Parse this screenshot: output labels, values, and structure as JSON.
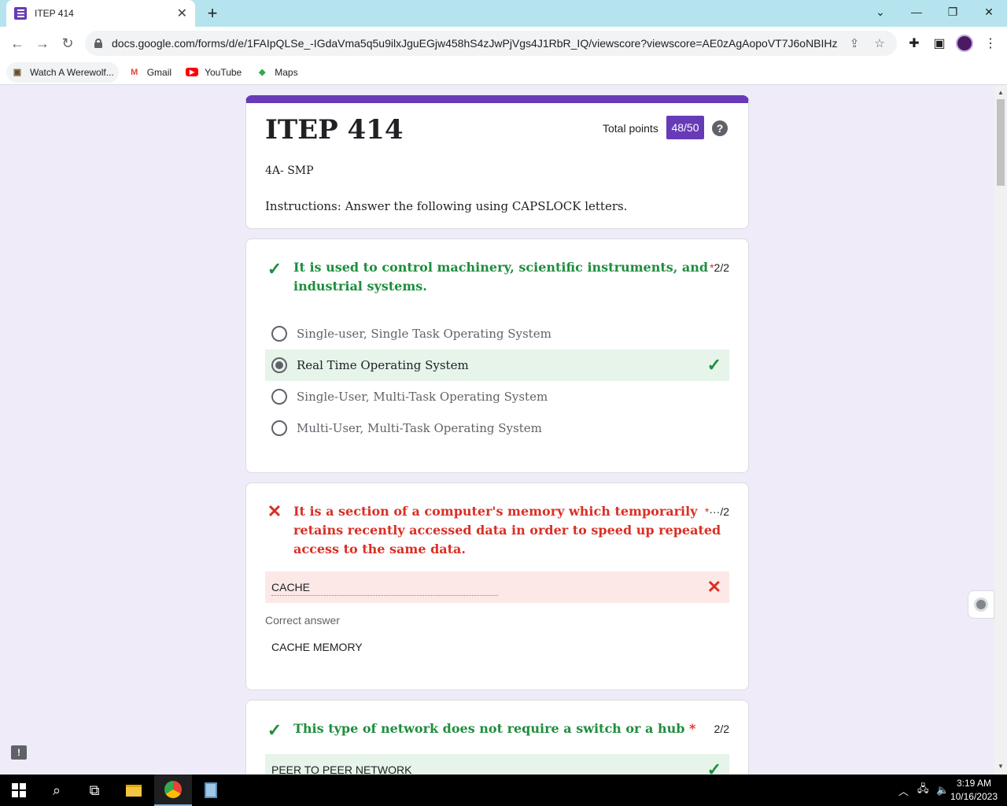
{
  "browser": {
    "tab_title": "ITEP 414",
    "url": "docs.google.com/forms/d/e/1FAIpQLSe_-IGdaVma5q5u9ilxJguEGjw458hS4zJwPjVgs4J1RbR_IQ/viewscore?viewscore=AE0zAgAopoVT7J6oNBIHz3i8u...",
    "bookmarks": [
      {
        "label": "Watch A Werewolf..."
      },
      {
        "label": "Gmail"
      },
      {
        "label": "YouTube"
      },
      {
        "label": "Maps"
      }
    ]
  },
  "form": {
    "title": "ITEP 414",
    "total_label": "Total points",
    "score": "48/50",
    "subtitle": "4A- SMP",
    "instructions": "Instructions: Answer the following using CAPSLOCK letters."
  },
  "questions": [
    {
      "text_line1": "It is used to control machinery, scientific instruments, and",
      "text_line2": "industrial systems.",
      "required_mark": "*",
      "points": "2/2",
      "options": [
        "Single-user, Single Task Operating System",
        "Real Time Operating System",
        "Single-User, Multi-Task Operating System",
        "Multi-User, Multi-Task Operating System"
      ]
    },
    {
      "text_line1": "It is a section of a computer's memory which temporarily",
      "text_line2": "retains recently accessed data in order to speed up repeated",
      "text_line3": "access to the same data.",
      "required_mark": "*",
      "points": "···/2",
      "answer": "CACHE",
      "correct_label": "Correct answer",
      "correct_value": "CACHE MEMORY"
    },
    {
      "text": "This type of network does not require a switch or a hub",
      "required_mark": "*",
      "points": "2/2",
      "answer": "PEER TO PEER NETWORK"
    }
  ],
  "taskbar": {
    "time": "3:19 AM",
    "date": "10/16/2023"
  }
}
